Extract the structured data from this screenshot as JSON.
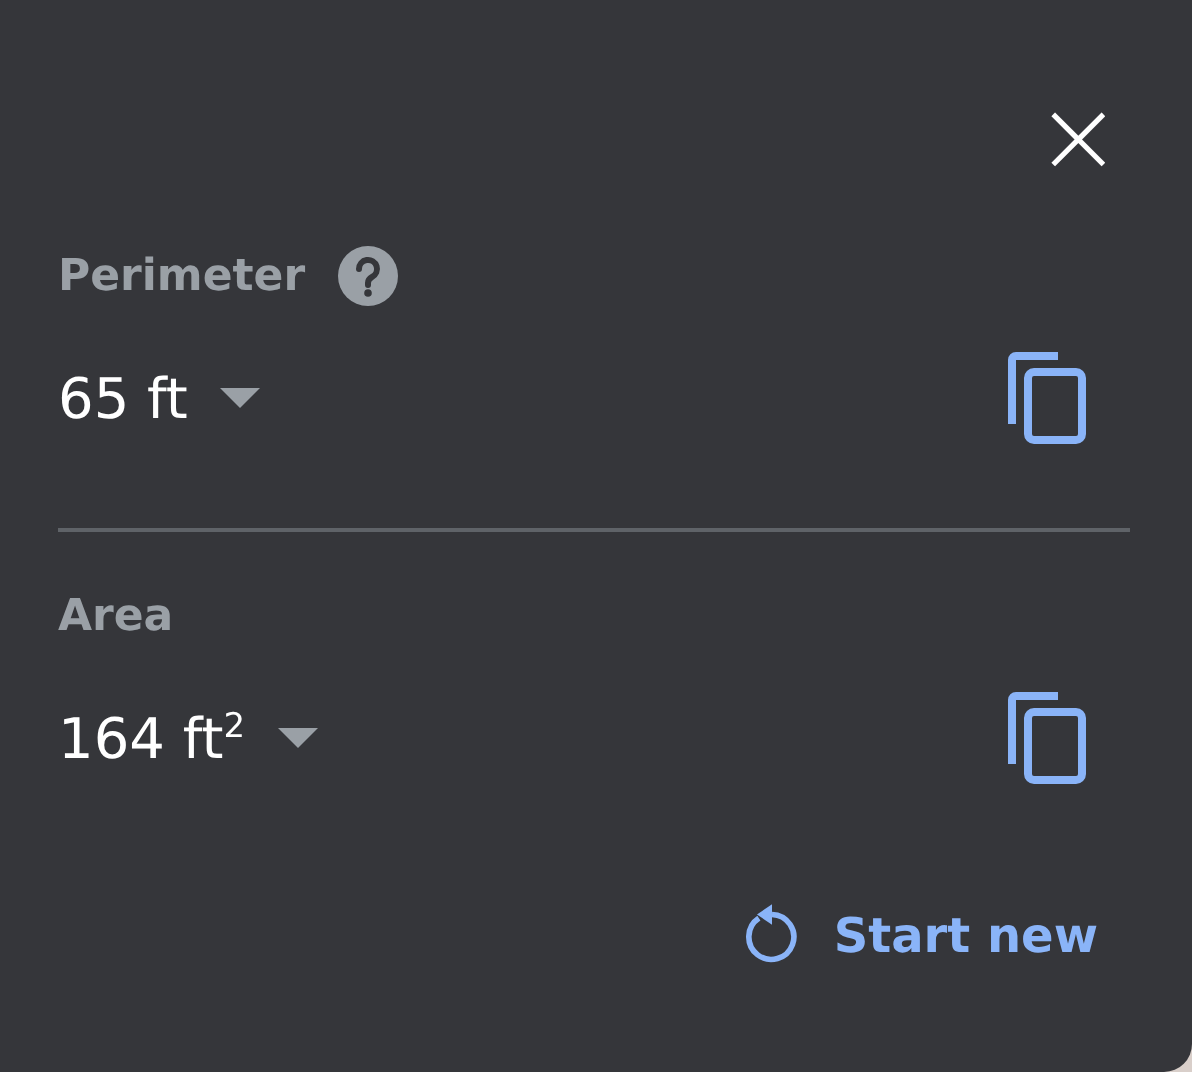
{
  "close_button": {
    "label": "×"
  },
  "measurements": [
    {
      "label": "Perimeter",
      "help": true,
      "value": "65 ft"
    },
    {
      "label": "Area",
      "help": false,
      "value": "164 ft$^{2}$"
    }
  ],
  "start_new_button": {
    "label": "Start new"
  }
}
